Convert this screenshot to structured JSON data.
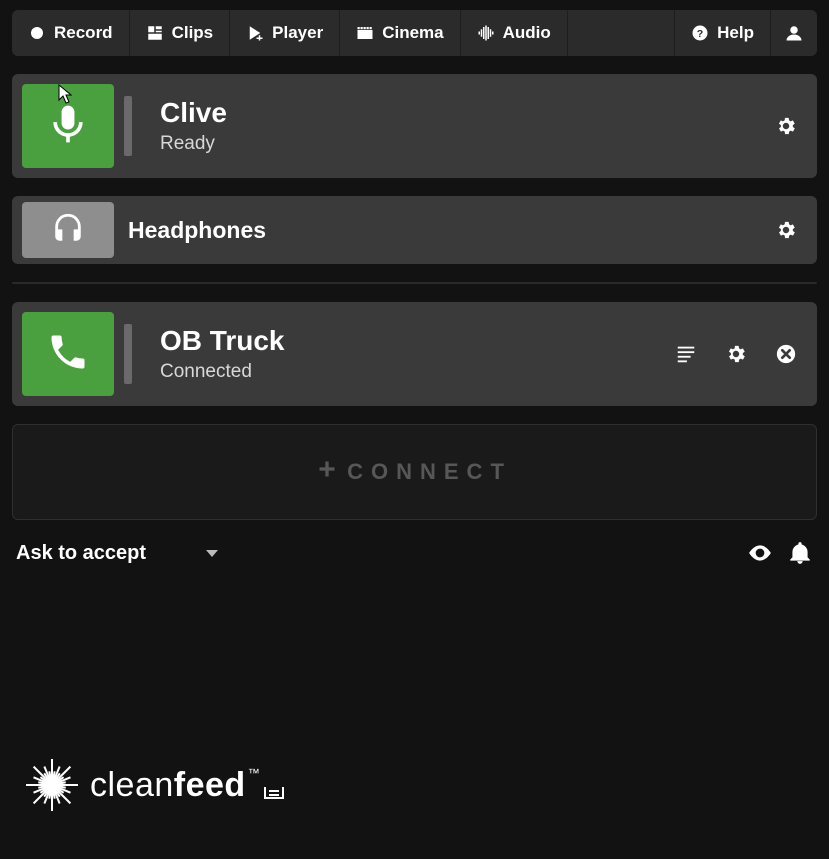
{
  "toolbar": {
    "record": "Record",
    "clips": "Clips",
    "player": "Player",
    "cinema": "Cinema",
    "audio": "Audio",
    "help": "Help"
  },
  "channels": [
    {
      "name": "Clive",
      "status": "Ready"
    }
  ],
  "headphones": {
    "label": "Headphones"
  },
  "connections": [
    {
      "name": "OB Truck",
      "status": "Connected"
    }
  ],
  "connect_label": "CONNECT",
  "accept_mode": {
    "label": "Ask to accept"
  },
  "brand": {
    "part1": "clean",
    "part2": "feed"
  }
}
